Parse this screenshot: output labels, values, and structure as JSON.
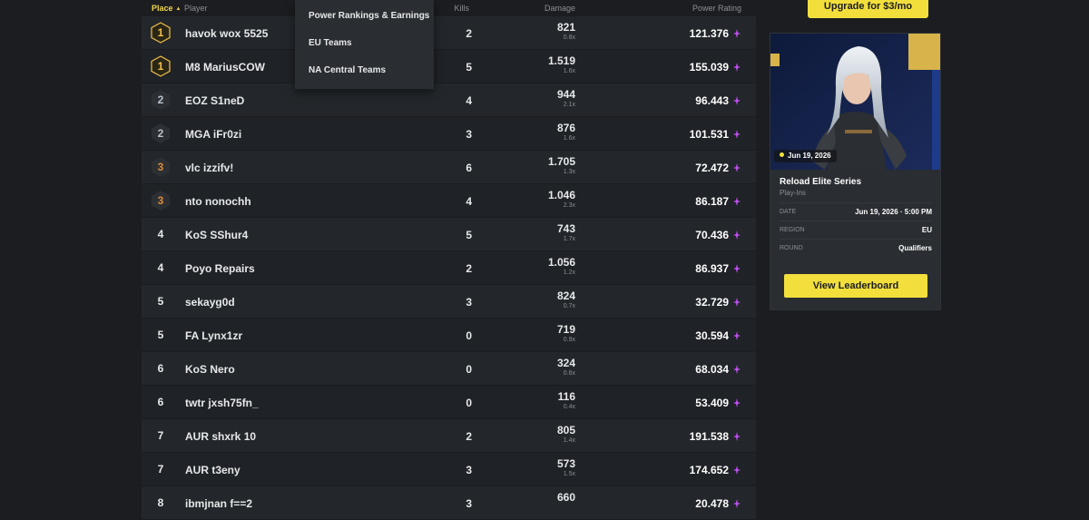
{
  "table": {
    "headers": {
      "place": "Place",
      "player": "Player",
      "kills": "Kills",
      "damage": "Damage",
      "power": "Power Rating"
    },
    "rows": [
      {
        "place": "1",
        "player": "havok wox 5525",
        "kills": "2",
        "damage": "821",
        "damage_mult": "0.8x",
        "power": "121.376"
      },
      {
        "place": "1",
        "player": "M8 MariusCOW",
        "kills": "5",
        "damage": "1.519",
        "damage_mult": "1.6x",
        "power": "155.039"
      },
      {
        "place": "2",
        "player": "EOZ S1neD",
        "kills": "4",
        "damage": "944",
        "damage_mult": "2.1x",
        "power": "96.443"
      },
      {
        "place": "2",
        "player": "MGA iFr0zi",
        "kills": "3",
        "damage": "876",
        "damage_mult": "1.6x",
        "power": "101.531"
      },
      {
        "place": "3",
        "player": "vlc izzifv!",
        "kills": "6",
        "damage": "1.705",
        "damage_mult": "1.3x",
        "power": "72.472"
      },
      {
        "place": "3",
        "player": "nto nonochh",
        "kills": "4",
        "damage": "1.046",
        "damage_mult": "2.3x",
        "power": "86.187"
      },
      {
        "place": "4",
        "player": "KoS SShur4",
        "kills": "5",
        "damage": "743",
        "damage_mult": "1.7x",
        "power": "70.436"
      },
      {
        "place": "4",
        "player": "Poyo Repairs",
        "kills": "2",
        "damage": "1.056",
        "damage_mult": "1.2x",
        "power": "86.937"
      },
      {
        "place": "5",
        "player": "sekayg0d",
        "kills": "3",
        "damage": "824",
        "damage_mult": "0.7x",
        "power": "32.729"
      },
      {
        "place": "5",
        "player": "FA Lynx1zr",
        "kills": "0",
        "damage": "719",
        "damage_mult": "0.9x",
        "power": "30.594"
      },
      {
        "place": "6",
        "player": "KoS Nero",
        "kills": "0",
        "damage": "324",
        "damage_mult": "0.6x",
        "power": "68.034"
      },
      {
        "place": "6",
        "player": "twtr jxsh75fn_",
        "kills": "0",
        "damage": "116",
        "damage_mult": "0.4x",
        "power": "53.409"
      },
      {
        "place": "7",
        "player": "AUR shxrk 10",
        "kills": "2",
        "damage": "805",
        "damage_mult": "1.4x",
        "power": "191.538"
      },
      {
        "place": "7",
        "player": "AUR t3eny",
        "kills": "3",
        "damage": "573",
        "damage_mult": "1.5x",
        "power": "174.652"
      },
      {
        "place": "8",
        "player": "ibmjnan f==2",
        "kills": "3",
        "damage": "660",
        "damage_mult": "",
        "power": "20.478"
      }
    ]
  },
  "dropdown": {
    "items": [
      "Power Rankings & Earnings",
      "EU Teams",
      "NA Central Teams"
    ]
  },
  "upgrade_label": "Upgrade for $3/mo",
  "event_card": {
    "date_badge": "Jun 19, 2026",
    "title": "Reload Elite Series",
    "subtitle": "Play-Ins",
    "info": [
      {
        "key": "DATE",
        "value": "Jun 19, 2026 · 5:00 PM"
      },
      {
        "key": "REGION",
        "value": "EU"
      },
      {
        "key": "ROUND",
        "value": "Qualifiers"
      }
    ],
    "button_label": "View Leaderboard"
  },
  "colors": {
    "accent": "#f2df3c",
    "gold": "#f2c14a",
    "silver": "#b9c2cc",
    "bronze": "#d98a3d",
    "power_icon": "#c04ef2"
  }
}
